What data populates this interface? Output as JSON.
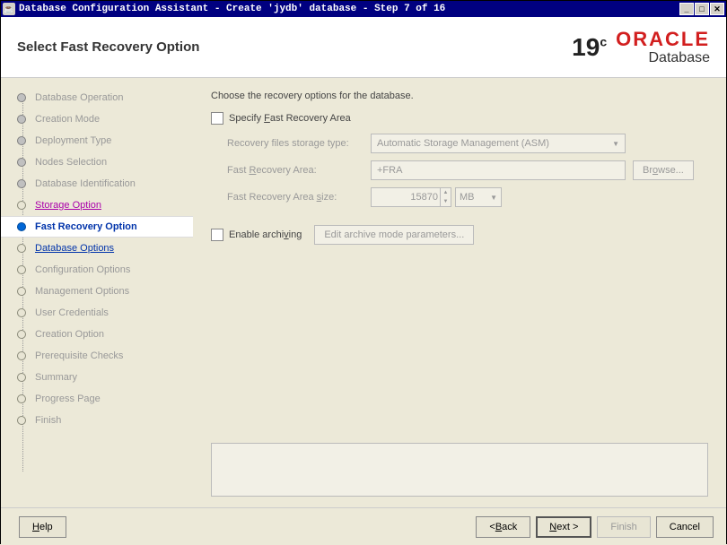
{
  "titlebar": {
    "text": "Database Configuration Assistant - Create 'jydb' database - Step 7 of 16"
  },
  "header": {
    "title": "Select Fast Recovery Option",
    "version": "19",
    "version_sup": "c",
    "brand_top": "ORACLE",
    "brand_bot": "Database"
  },
  "steps": [
    {
      "label": "Database Operation",
      "state": "visited"
    },
    {
      "label": "Creation Mode",
      "state": "visited"
    },
    {
      "label": "Deployment Type",
      "state": "visited"
    },
    {
      "label": "Nodes Selection",
      "state": "visited"
    },
    {
      "label": "Database Identification",
      "state": "visited"
    },
    {
      "label": "Storage Option",
      "state": "prev-link"
    },
    {
      "label": "Fast Recovery Option",
      "state": "current"
    },
    {
      "label": "Database Options",
      "state": "link"
    },
    {
      "label": "Configuration Options",
      "state": "pending"
    },
    {
      "label": "Management Options",
      "state": "pending"
    },
    {
      "label": "User Credentials",
      "state": "pending"
    },
    {
      "label": "Creation Option",
      "state": "pending"
    },
    {
      "label": "Prerequisite Checks",
      "state": "pending"
    },
    {
      "label": "Summary",
      "state": "pending"
    },
    {
      "label": "Progress Page",
      "state": "pending"
    },
    {
      "label": "Finish",
      "state": "pending"
    }
  ],
  "main": {
    "instruction": "Choose the recovery options for the database.",
    "specify_fra_label": "Specify Fast Recovery Area",
    "storage_type_label": "Recovery files storage type:",
    "storage_type_value": "Automatic Storage Management (ASM)",
    "fra_label": "Fast Recovery Area:",
    "fra_value": "+FRA",
    "browse_label": "Browse...",
    "fra_size_label": "Fast Recovery Area size:",
    "fra_size_value": "15870",
    "fra_size_unit": "MB",
    "enable_arch_label": "Enable archiving",
    "edit_arch_label": "Edit archive mode parameters..."
  },
  "footer": {
    "help": "Help",
    "back": "< Back",
    "next": "Next >",
    "finish": "Finish",
    "cancel": "Cancel"
  }
}
